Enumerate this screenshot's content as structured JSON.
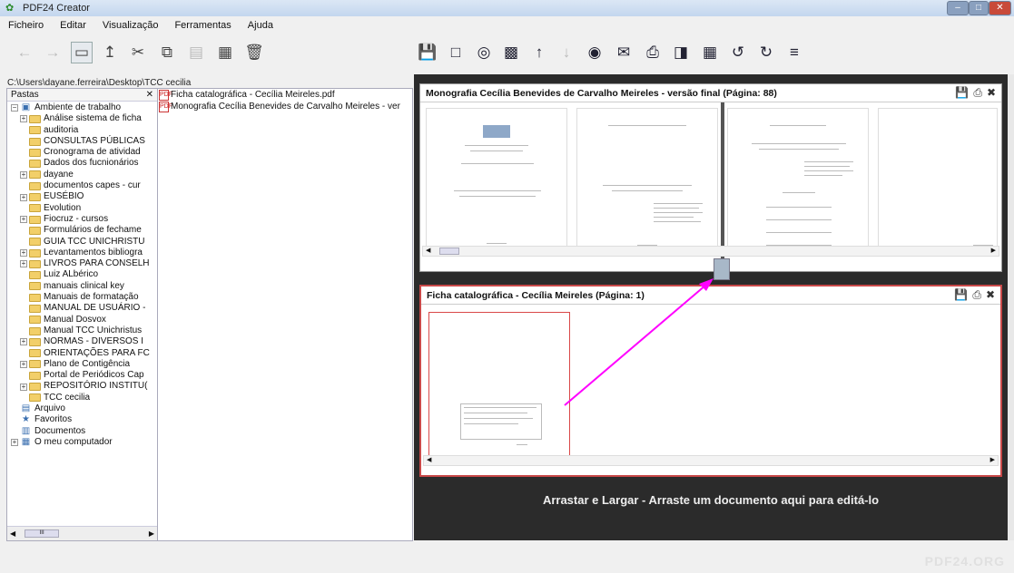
{
  "window": {
    "title": "PDF24 Creator"
  },
  "menu": [
    "Ficheiro",
    "Editar",
    "Visualização",
    "Ferramentas",
    "Ajuda"
  ],
  "path": "C:\\Users\\dayane.ferreira\\Desktop\\TCC cecilia",
  "folders_header": "Pastas",
  "tree": [
    {
      "label": "Ambiente de trabalho",
      "level": 0,
      "expander": "−",
      "icon": "desktop-icon"
    },
    {
      "label": "Análise sistema de ficha",
      "level": 1,
      "expander": "+",
      "icon": "folder-icon"
    },
    {
      "label": "auditoria",
      "level": 1,
      "expander": "",
      "icon": "folder-icon"
    },
    {
      "label": "CONSULTAS PÚBLICAS",
      "level": 1,
      "expander": "",
      "icon": "folder-icon"
    },
    {
      "label": "Cronograma de atividad",
      "level": 1,
      "expander": "",
      "icon": "folder-icon"
    },
    {
      "label": "Dados dos fucnionários",
      "level": 1,
      "expander": "",
      "icon": "folder-icon"
    },
    {
      "label": "dayane",
      "level": 1,
      "expander": "+",
      "icon": "folder-icon"
    },
    {
      "label": "documentos capes - cur",
      "level": 1,
      "expander": "",
      "icon": "folder-icon"
    },
    {
      "label": "EUSÉBIO",
      "level": 1,
      "expander": "+",
      "icon": "folder-icon"
    },
    {
      "label": "Evolution",
      "level": 1,
      "expander": "",
      "icon": "folder-icon"
    },
    {
      "label": "Fiocruz - cursos",
      "level": 1,
      "expander": "+",
      "icon": "folder-icon"
    },
    {
      "label": "Formulários de fechame",
      "level": 1,
      "expander": "",
      "icon": "folder-icon"
    },
    {
      "label": "GUIA TCC UNICHRISTU",
      "level": 1,
      "expander": "",
      "icon": "folder-icon"
    },
    {
      "label": "Levantamentos bibliogra",
      "level": 1,
      "expander": "+",
      "icon": "folder-icon"
    },
    {
      "label": "LIVROS PARA CONSELH",
      "level": 1,
      "expander": "+",
      "icon": "folder-icon"
    },
    {
      "label": "Luiz ALbérico",
      "level": 1,
      "expander": "",
      "icon": "folder-icon"
    },
    {
      "label": "manuais clinical key",
      "level": 1,
      "expander": "",
      "icon": "folder-icon"
    },
    {
      "label": "Manuais de formatação",
      "level": 1,
      "expander": "",
      "icon": "folder-icon"
    },
    {
      "label": "MANUAL DE USUÁRIO -",
      "level": 1,
      "expander": "",
      "icon": "folder-icon"
    },
    {
      "label": "Manual Dosvox",
      "level": 1,
      "expander": "",
      "icon": "folder-icon"
    },
    {
      "label": "Manual TCC Unichristus",
      "level": 1,
      "expander": "",
      "icon": "folder-icon"
    },
    {
      "label": "NORMAS -  DIVERSOS I",
      "level": 1,
      "expander": "+",
      "icon": "folder-icon"
    },
    {
      "label": "ORIENTAÇÕES PARA FC",
      "level": 1,
      "expander": "",
      "icon": "folder-icon"
    },
    {
      "label": "Plano de Contigência",
      "level": 1,
      "expander": "+",
      "icon": "folder-icon"
    },
    {
      "label": "Portal de Periódicos Cap",
      "level": 1,
      "expander": "",
      "icon": "folder-icon"
    },
    {
      "label": "REPOSITÓRIO INSTITU(",
      "level": 1,
      "expander": "+",
      "icon": "folder-icon"
    },
    {
      "label": "TCC cecilia",
      "level": 1,
      "expander": "",
      "icon": "folder-icon"
    },
    {
      "label": "Arquivo",
      "level": 0,
      "expander": "",
      "icon": "archive-icon"
    },
    {
      "label": "Favoritos",
      "level": 0,
      "expander": "",
      "icon": "star-icon"
    },
    {
      "label": "Documentos",
      "level": 0,
      "expander": "",
      "icon": "documents-icon"
    },
    {
      "label": "O meu computador",
      "level": 0,
      "expander": "+",
      "icon": "computer-icon"
    }
  ],
  "files": [
    "Ficha catalográfica - Cecília Meireles.pdf",
    "Monografia Cecília Benevides de Carvalho Meireles - ver"
  ],
  "doc1": {
    "title": "Monografia Cecília Benevides de Carvalho Meireles - versão final (Página: 88)"
  },
  "doc2": {
    "title": "Ficha catalográfica - Cecília Meireles (Página: 1)"
  },
  "drop_hint": "Arrastar e Largar - Arraste um documento aqui para editá-lo",
  "brand": "PDF24.ORG",
  "scroll_marker": "III",
  "colors": {
    "arrow": "#ff00ff",
    "selected_page_border": "#d94848",
    "app_bg": "#2b2b2b"
  }
}
